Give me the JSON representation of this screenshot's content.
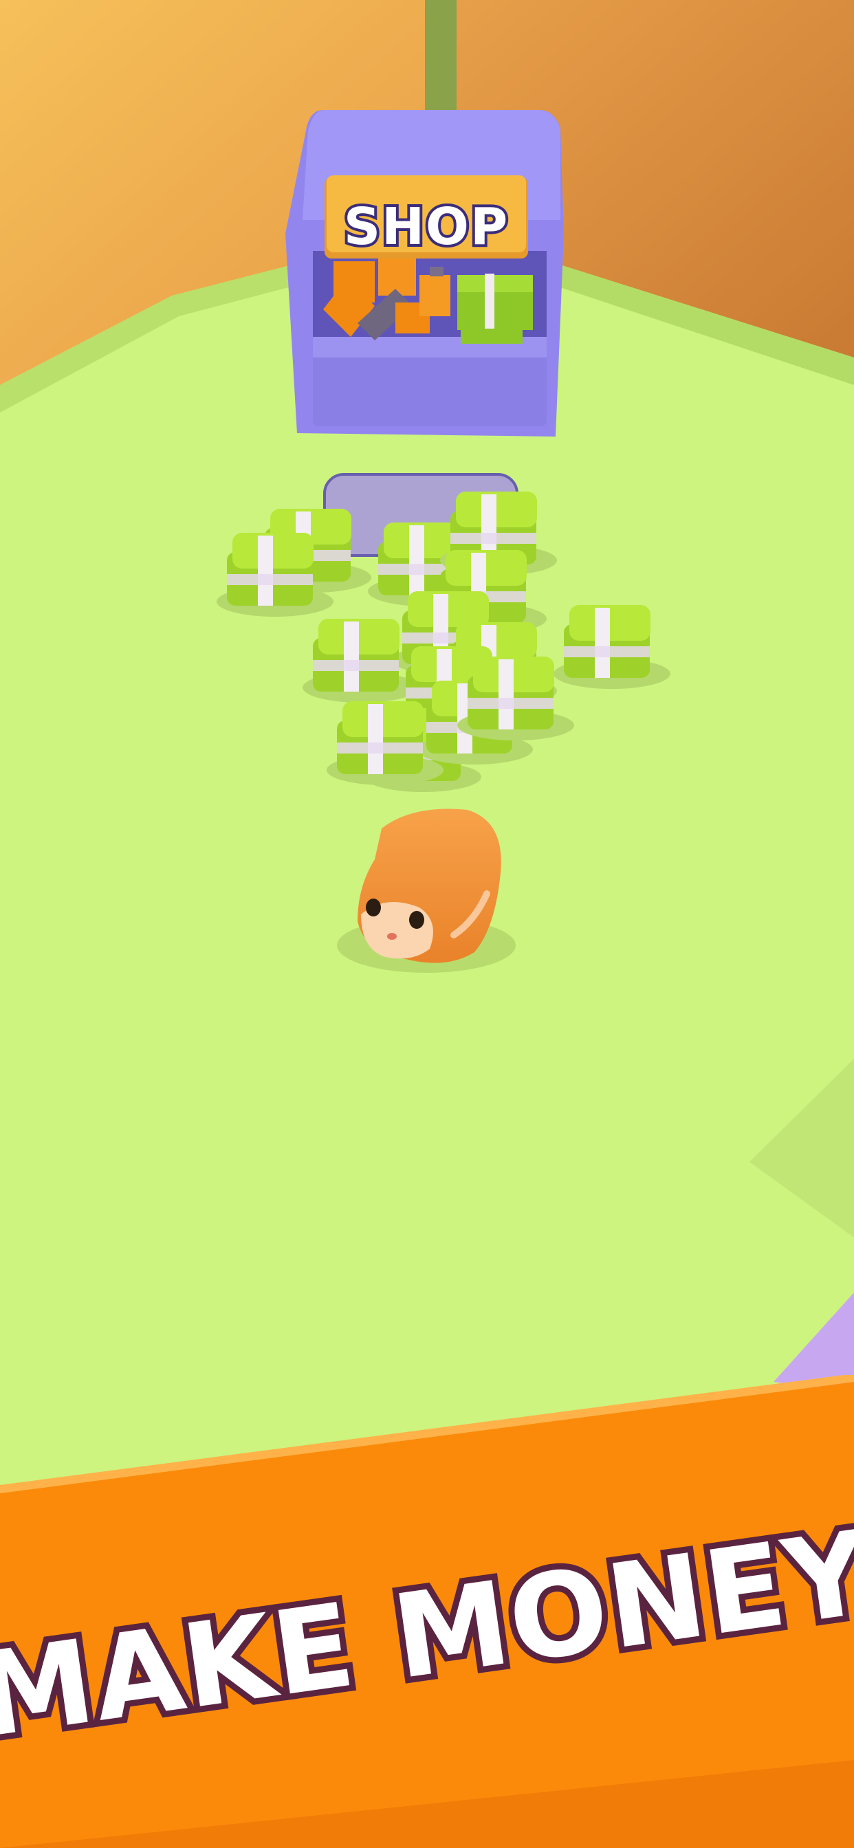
{
  "scene": {
    "shop_sign": "SHOP",
    "money_stack_count": 14,
    "colors": {
      "floor": "#cdf47f",
      "wall_left": "#eba44a",
      "wall_right": "#d98938",
      "shop_body": "#8b7fe6",
      "money_green": "#a6dc2e",
      "hamster": "#f59a3c",
      "banner": "#fc8a0a"
    }
  },
  "banner": {
    "title": "MAKE MONEY"
  }
}
